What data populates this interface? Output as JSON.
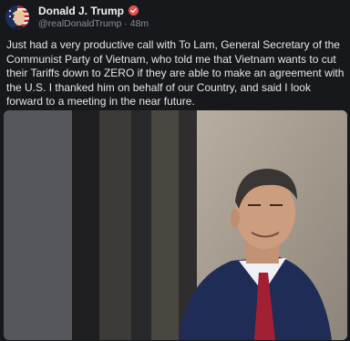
{
  "post": {
    "author": {
      "display_name": "Donald J. Trump",
      "handle": "@realDonaldTrump",
      "time_ago": "48m",
      "separator": "·",
      "verified": true,
      "verified_color": "#e4514f"
    },
    "text": "Just had a very productive call with To Lam, General Secretary of the Communist Party of Vietnam, who told me that Vietnam wants to cut their Tariffs down to ZERO if they are able to make an agreement with the U.S. I thanked him on behalf of our Country, and said I look forward to a meeting in the near future.",
    "media_icon": "photo-of-man-in-suit"
  },
  "colors": {
    "background": "#17181c",
    "text": "#e6e6e9",
    "muted": "#8c8e96"
  }
}
